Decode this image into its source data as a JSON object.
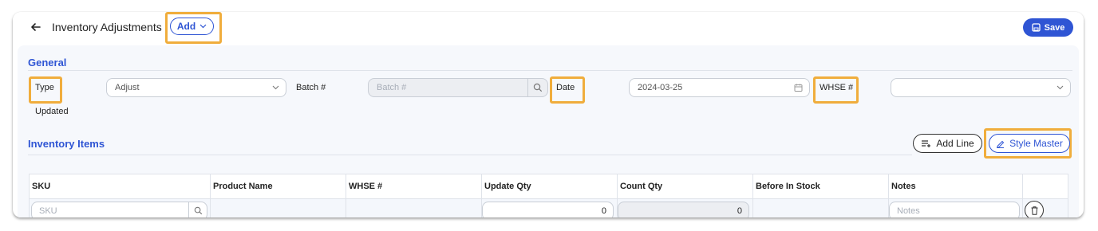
{
  "header": {
    "title": "Inventory Adjustments",
    "add_label": "Add",
    "save_label": "Save"
  },
  "general": {
    "section_title": "General",
    "type_label": "Type",
    "type_value": "Adjust",
    "batch_label": "Batch #",
    "batch_placeholder": "Batch #",
    "date_label": "Date",
    "date_value": "2024-03-25",
    "whse_label": "WHSE #",
    "whse_value": "",
    "status_text": "Updated"
  },
  "items": {
    "section_title": "Inventory Items",
    "add_line_label": "Add Line",
    "style_master_label": "Style Master",
    "columns": [
      "SKU",
      "Product Name",
      "WHSE #",
      "Update Qty",
      "Count Qty",
      "Before In Stock",
      "Notes",
      ""
    ],
    "row": {
      "sku_placeholder": "SKU",
      "update_qty": "0",
      "count_qty": "0",
      "notes_placeholder": "Notes"
    }
  },
  "colors": {
    "accent": "#2f55d4",
    "highlight": "#f0ad3c",
    "panel_bg": "#f6f8fc"
  },
  "icons": [
    "back-arrow-icon",
    "chevron-down-icon",
    "save-icon",
    "search-icon",
    "calendar-icon",
    "add-line-icon",
    "edit-icon",
    "trash-icon"
  ]
}
